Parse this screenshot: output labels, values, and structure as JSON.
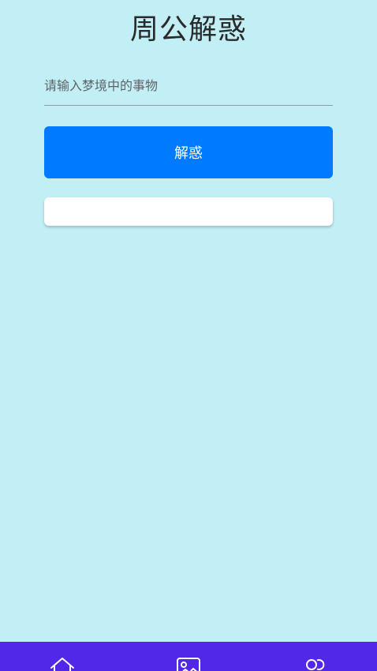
{
  "header": {
    "title": "周公解惑"
  },
  "form": {
    "input_value": "",
    "input_placeholder": "请输入梦境中的事物",
    "submit_label": "解惑"
  },
  "result": {
    "text": ""
  },
  "bottom_nav": {
    "background": "#5127e8",
    "items": [
      {
        "icon": "home-icon"
      },
      {
        "icon": "image-icon"
      },
      {
        "icon": "users-icon"
      }
    ]
  },
  "colors": {
    "page_background": "#c1eff5",
    "primary": "#007bff"
  }
}
